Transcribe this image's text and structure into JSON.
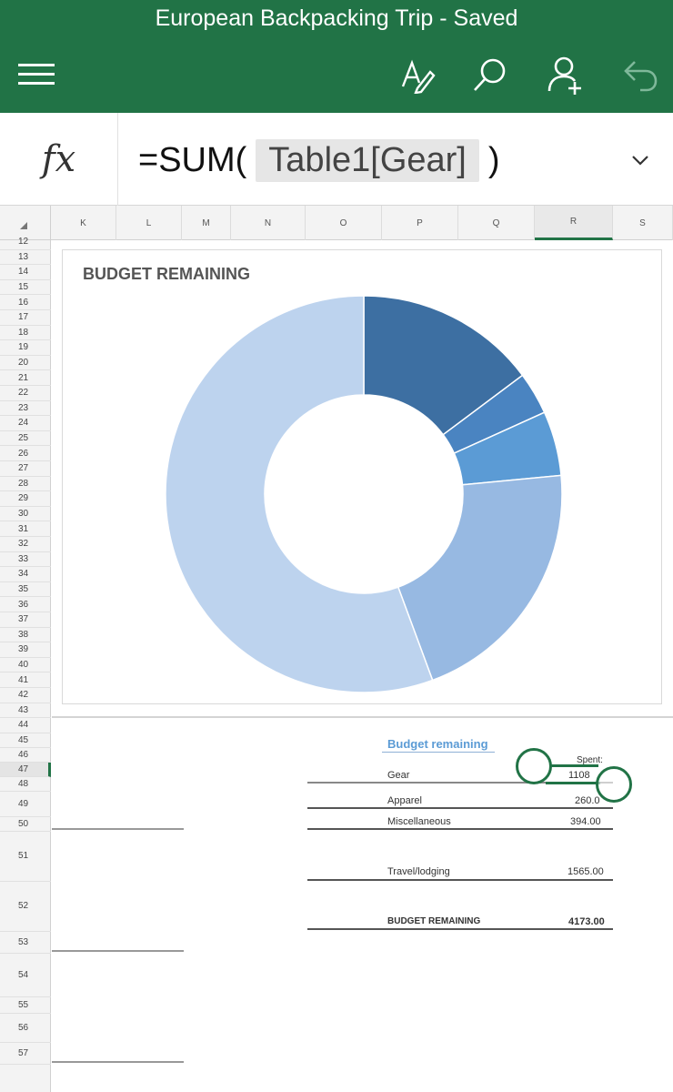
{
  "app": {
    "title": "European Backpacking Trip - Saved"
  },
  "toolbar": {
    "menu_icon": "hamburger-menu-icon",
    "draw_icon": "pen-draw-icon",
    "search_icon": "search-icon",
    "share_icon": "add-person-icon",
    "undo_icon": "undo-icon"
  },
  "formula_bar": {
    "fx_label": "fx",
    "formula_prefix": "=SUM(",
    "formula_ref": "Table1[Gear]",
    "formula_suffix": ")"
  },
  "columns": [
    "K",
    "L",
    "M",
    "N",
    "O",
    "P",
    "Q",
    "R",
    "S"
  ],
  "active_column": "R",
  "rows": [
    "12",
    "13",
    "14",
    "15",
    "16",
    "17",
    "18",
    "19",
    "20",
    "21",
    "22",
    "23",
    "24",
    "25",
    "26",
    "27",
    "28",
    "29",
    "30",
    "31",
    "32",
    "33",
    "34",
    "35",
    "36",
    "37",
    "38",
    "39",
    "40",
    "41",
    "42",
    "43",
    "44",
    "45",
    "46",
    "47",
    "48",
    "49",
    "50",
    "51",
    "52",
    "53",
    "54",
    "55",
    "56",
    "57"
  ],
  "active_row": "47",
  "chart_data": {
    "type": "pie",
    "title": "BUDGET REMAINING",
    "hole": 0.5,
    "slices": [
      {
        "label": "Gear",
        "value": 1108,
        "color": "#3d6fa2"
      },
      {
        "label": "Apparel",
        "value": 260,
        "color": "#4a84c1"
      },
      {
        "label": "Miscellaneous",
        "value": 394,
        "color": "#5b9bd5"
      },
      {
        "label": "Travel/lodging",
        "value": 1565,
        "color": "#97b9e2"
      },
      {
        "label": "BUDGET REMAINING",
        "value": 4173,
        "color": "#bdd3ee"
      }
    ]
  },
  "table": {
    "title": "Budget remaining",
    "spent_header": "Spent:",
    "rows": [
      {
        "label": "Gear",
        "value": "1108"
      },
      {
        "label": "Apparel",
        "value": "260.0"
      },
      {
        "label": "Miscellaneous",
        "value": "394.00"
      },
      {
        "label": "Travel/lodging",
        "value": "1565.00"
      },
      {
        "label": "BUDGET REMAINING",
        "value": "4173.00"
      }
    ]
  },
  "colors": {
    "accent": "#217346"
  }
}
